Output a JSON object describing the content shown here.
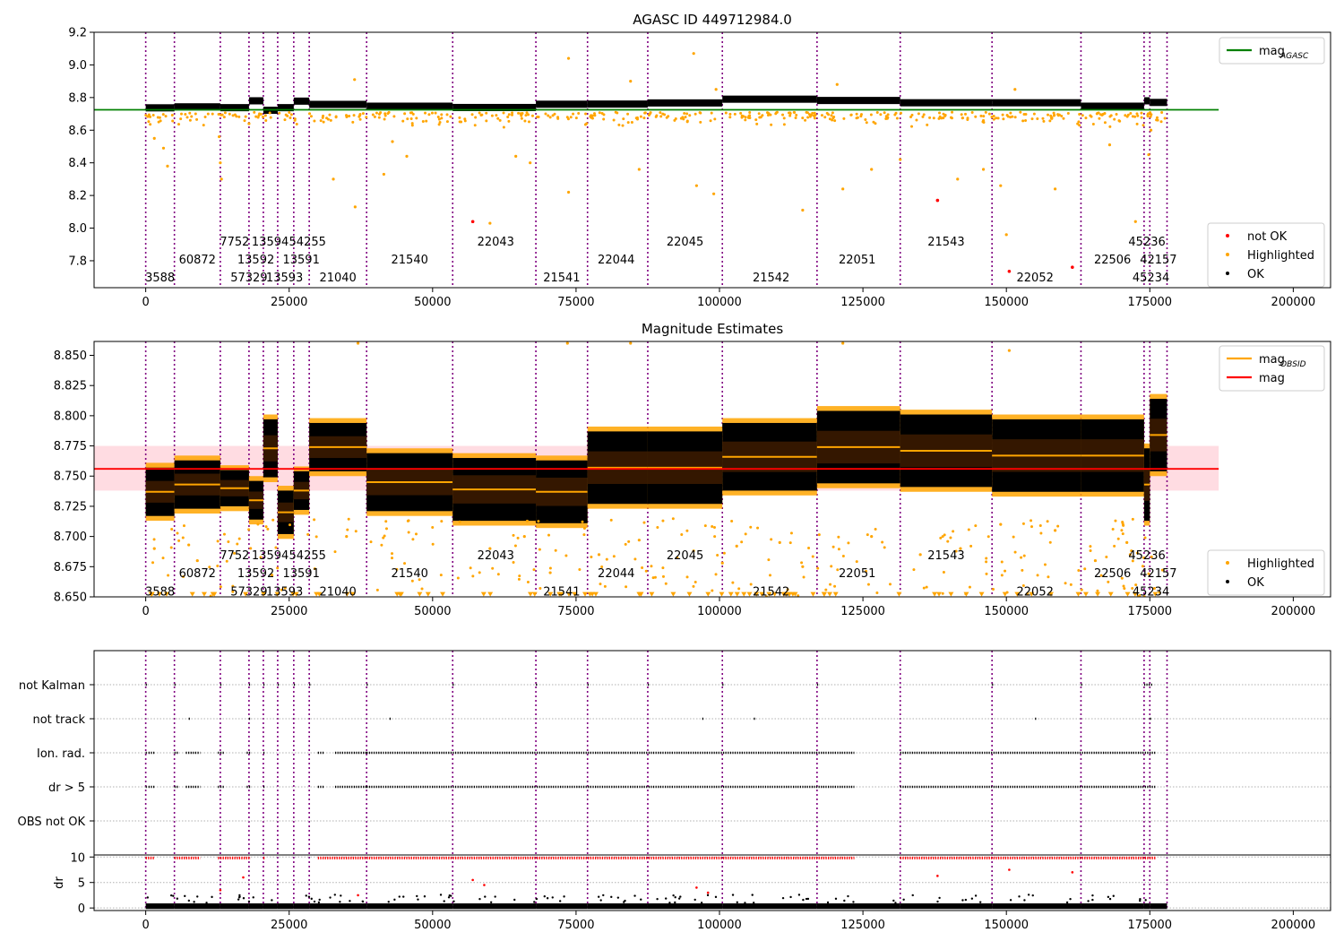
{
  "colors": {
    "ok": "#000000",
    "highlighted": "#ffa500",
    "not_ok": "#ff0000",
    "mag_agasc": "#008000",
    "mag_obsid": "#ffa500",
    "mag": "#ff0000",
    "mag_band": "#ffc0cb",
    "obsid_line": "#800080",
    "grid": "#b0b0b0"
  },
  "obsid_boundaries": [
    0,
    5000,
    13000,
    18000,
    20500,
    23000,
    25800,
    28500,
    38500,
    53500,
    68000,
    77000,
    87500,
    100500,
    117000,
    131500,
    147500,
    163000,
    174000,
    175000,
    178000
  ],
  "obsid_labels": [
    {
      "text": "3588",
      "x": 2500,
      "row": 0
    },
    {
      "text": "60872",
      "x": 9000,
      "row": 1
    },
    {
      "text": "7752",
      "x": 15500,
      "row": 2
    },
    {
      "text": "57329",
      "x": 18000,
      "row": 0
    },
    {
      "text": "13592",
      "x": 19200,
      "row": 1
    },
    {
      "text": "13594",
      "x": 21700,
      "row": 2
    },
    {
      "text": "13593",
      "x": 24200,
      "row": 0
    },
    {
      "text": "13591",
      "x": 27100,
      "row": 1
    },
    {
      "text": "54255",
      "x": 28200,
      "row": 2
    },
    {
      "text": "21040",
      "x": 33500,
      "row": 0
    },
    {
      "text": "21540",
      "x": 46000,
      "row": 1
    },
    {
      "text": "22043",
      "x": 61000,
      "row": 2
    },
    {
      "text": "21541",
      "x": 72500,
      "row": 0
    },
    {
      "text": "22044",
      "x": 82000,
      "row": 1
    },
    {
      "text": "22045",
      "x": 94000,
      "row": 2
    },
    {
      "text": "21542",
      "x": 109000,
      "row": 0
    },
    {
      "text": "22051",
      "x": 124000,
      "row": 1
    },
    {
      "text": "21543",
      "x": 139500,
      "row": 2
    },
    {
      "text": "22052",
      "x": 155000,
      "row": 0
    },
    {
      "text": "22506",
      "x": 168500,
      "row": 1
    },
    {
      "text": "45236",
      "x": 174500,
      "row": 2
    },
    {
      "text": "42157",
      "x": 176500,
      "row": 1
    },
    {
      "text": "45234",
      "x": 175200,
      "row": 0
    }
  ],
  "chart_data": [
    {
      "type": "scatter",
      "title": "AGASC ID 449712984.0",
      "xlim": [
        -9000,
        206500
      ],
      "ylim": [
        7.635,
        9.2
      ],
      "xticks": [
        0,
        25000,
        50000,
        75000,
        100000,
        125000,
        150000,
        175000,
        200000
      ],
      "yticks": [
        7.8,
        8.0,
        8.2,
        8.4,
        8.6,
        8.8,
        9.0,
        9.2
      ],
      "ytick_labels": [
        "7.8",
        "8.0",
        "8.2",
        "8.4",
        "8.6",
        "8.8",
        "9.0",
        "9.2"
      ],
      "mag_agasc": 8.725,
      "mag_agasc_xrange": [
        -9000,
        187000
      ],
      "obsid_mags": [
        8.737,
        8.743,
        8.738,
        8.78,
        8.722,
        8.738,
        8.778,
        8.758,
        8.747,
        8.739,
        8.759,
        8.76,
        8.767,
        8.79,
        8.782,
        8.768,
        8.768,
        8.747,
        8.78,
        8.77
      ],
      "not_ok_points": [
        {
          "x": 57000,
          "y": 8.04
        },
        {
          "x": 138000,
          "y": 8.17
        },
        {
          "x": 150500,
          "y": 7.735
        },
        {
          "x": 161500,
          "y": 7.76
        }
      ],
      "highlighted_sample": [
        {
          "x": 1500,
          "y": 8.55
        },
        {
          "x": 3100,
          "y": 8.49
        },
        {
          "x": 3800,
          "y": 8.38
        },
        {
          "x": 13000,
          "y": 8.4
        },
        {
          "x": 13200,
          "y": 8.3
        },
        {
          "x": 12800,
          "y": 8.56
        },
        {
          "x": 18000,
          "y": 8.64
        },
        {
          "x": 36400,
          "y": 8.91
        },
        {
          "x": 32700,
          "y": 8.3
        },
        {
          "x": 36500,
          "y": 8.13
        },
        {
          "x": 43000,
          "y": 8.53
        },
        {
          "x": 41500,
          "y": 8.33
        },
        {
          "x": 45500,
          "y": 8.44
        },
        {
          "x": 60000,
          "y": 8.03
        },
        {
          "x": 64500,
          "y": 8.44
        },
        {
          "x": 67000,
          "y": 8.4
        },
        {
          "x": 73700,
          "y": 9.04
        },
        {
          "x": 73700,
          "y": 8.22
        },
        {
          "x": 84500,
          "y": 8.9
        },
        {
          "x": 86000,
          "y": 8.36
        },
        {
          "x": 95500,
          "y": 9.07
        },
        {
          "x": 96000,
          "y": 8.26
        },
        {
          "x": 99000,
          "y": 8.21
        },
        {
          "x": 99400,
          "y": 8.85
        },
        {
          "x": 114500,
          "y": 8.11
        },
        {
          "x": 120500,
          "y": 8.88
        },
        {
          "x": 121500,
          "y": 8.24
        },
        {
          "x": 126500,
          "y": 8.36
        },
        {
          "x": 131500,
          "y": 8.42
        },
        {
          "x": 141500,
          "y": 8.3
        },
        {
          "x": 146000,
          "y": 8.36
        },
        {
          "x": 149000,
          "y": 8.26
        },
        {
          "x": 150000,
          "y": 7.96
        },
        {
          "x": 158500,
          "y": 8.24
        },
        {
          "x": 151500,
          "y": 8.85
        },
        {
          "x": 168000,
          "y": 8.51
        },
        {
          "x": 172500,
          "y": 8.04
        },
        {
          "x": 174800,
          "y": 8.45
        },
        {
          "x": 175200,
          "y": 8.6
        }
      ],
      "legend_top": [
        {
          "label": "mag",
          "sub": "AGASC",
          "marker": "line",
          "color_key": "mag_agasc"
        }
      ],
      "legend_bottom": [
        {
          "label": "not OK",
          "marker": "dot",
          "color_key": "not_ok"
        },
        {
          "label": "Highlighted",
          "marker": "dot",
          "color_key": "highlighted"
        },
        {
          "label": "OK",
          "marker": "dot",
          "color_key": "ok"
        }
      ]
    },
    {
      "type": "scatter",
      "title": "Magnitude Estimates",
      "xlim": [
        -9000,
        206500
      ],
      "ylim": [
        8.65,
        8.8615
      ],
      "xticks": [
        0,
        25000,
        50000,
        75000,
        100000,
        125000,
        150000,
        175000,
        200000
      ],
      "yticks": [
        8.65,
        8.675,
        8.7,
        8.725,
        8.75,
        8.775,
        8.8,
        8.825,
        8.85
      ],
      "ytick_labels": [
        "8.650",
        "8.675",
        "8.700",
        "8.725",
        "8.750",
        "8.775",
        "8.800",
        "8.825",
        "8.850"
      ],
      "mag": 8.756,
      "mag_band": [
        8.738,
        8.775
      ],
      "mag_xrange": [
        -9000,
        187000
      ],
      "obsid_mags": [
        8.737,
        8.743,
        8.74,
        8.73,
        8.773,
        8.72,
        8.738,
        8.774,
        8.745,
        8.739,
        8.737,
        8.757,
        8.757,
        8.766,
        8.774,
        8.771,
        8.767,
        8.767,
        8.743,
        8.784,
        8.781
      ],
      "obsid_spread": [
        0.02,
        0.02,
        0.015,
        0.016,
        0.024,
        0.018,
        0.016,
        0.02,
        0.024,
        0.026,
        0.026,
        0.03,
        0.03,
        0.028,
        0.03,
        0.03,
        0.03,
        0.03,
        0.03,
        0.03,
        0.03
      ],
      "highlighted_sample": [
        {
          "x": 37000,
          "y": 8.86
        },
        {
          "x": 73500,
          "y": 8.86
        },
        {
          "x": 84500,
          "y": 8.86
        },
        {
          "x": 121500,
          "y": 8.86
        },
        {
          "x": 150500,
          "y": 8.854
        },
        {
          "x": 1500,
          "y": 8.69
        },
        {
          "x": 7500,
          "y": 8.693
        },
        {
          "x": 9000,
          "y": 8.68
        },
        {
          "x": 22000,
          "y": 8.668
        },
        {
          "x": 35000,
          "y": 8.7
        },
        {
          "x": 60000,
          "y": 8.69
        },
        {
          "x": 66000,
          "y": 8.7
        },
        {
          "x": 70500,
          "y": 8.67
        },
        {
          "x": 79000,
          "y": 8.685
        },
        {
          "x": 86000,
          "y": 8.697
        },
        {
          "x": 100500,
          "y": 8.678
        },
        {
          "x": 103000,
          "y": 8.692
        },
        {
          "x": 110500,
          "y": 8.695
        },
        {
          "x": 114500,
          "y": 8.675
        },
        {
          "x": 126500,
          "y": 8.7
        },
        {
          "x": 135000,
          "y": 8.685
        },
        {
          "x": 142000,
          "y": 8.69
        },
        {
          "x": 149000,
          "y": 8.71
        },
        {
          "x": 158500,
          "y": 8.705
        },
        {
          "x": 165500,
          "y": 8.68
        },
        {
          "x": 171000,
          "y": 8.695
        }
      ],
      "legend_top": [
        {
          "label": "mag",
          "sub": "OBSID",
          "marker": "line",
          "color_key": "mag_obsid"
        },
        {
          "label": "mag",
          "marker": "line",
          "color_key": "mag"
        }
      ],
      "legend_bottom": [
        {
          "label": "Highlighted",
          "marker": "dot",
          "color_key": "highlighted"
        },
        {
          "label": "OK",
          "marker": "dot",
          "color_key": "ok"
        }
      ]
    },
    {
      "type": "scatter",
      "title": "",
      "xlim": [
        -9000,
        206500
      ],
      "xticks": [
        0,
        25000,
        50000,
        75000,
        100000,
        125000,
        150000,
        175000,
        200000
      ],
      "categories": [
        "not Kalman",
        "not track",
        "Ion. rad.",
        "dr > 5",
        "OBS not OK"
      ],
      "flag_segments": {
        "not Kalman": [
          [
            0,
            200
          ],
          [
            5000,
            5200
          ],
          [
            13000,
            13200
          ],
          [
            18000,
            18300
          ],
          [
            20500,
            20700
          ],
          [
            23000,
            23200
          ],
          [
            25800,
            26000
          ],
          [
            28500,
            28800
          ],
          [
            38500,
            38700
          ],
          [
            53500,
            53700
          ],
          [
            68000,
            68200
          ],
          [
            77000,
            77200
          ],
          [
            87500,
            87700
          ],
          [
            100500,
            100700
          ],
          [
            117000,
            117200
          ],
          [
            147500,
            147700
          ],
          [
            163000,
            163200
          ],
          [
            174000,
            175500
          ]
        ],
        "not track": [
          [
            7500,
            7700
          ],
          [
            18000,
            18200
          ],
          [
            42500,
            42700
          ],
          [
            97000,
            97200
          ],
          [
            106000,
            106200
          ],
          [
            155000,
            155200
          ],
          [
            175000,
            175200
          ]
        ],
        "Ion. rad.": [
          [
            0,
            200
          ],
          [
            500,
            1500
          ],
          [
            5000,
            5600
          ],
          [
            7000,
            9500
          ],
          [
            12600,
            13600
          ],
          [
            17600,
            18300
          ],
          [
            20500,
            20800
          ],
          [
            30000,
            31000
          ],
          [
            33000,
            38500
          ],
          [
            38500,
            123500
          ],
          [
            131500,
            176000
          ]
        ],
        "dr > 5": [
          [
            0,
            200
          ],
          [
            500,
            1500
          ],
          [
            5000,
            5600
          ],
          [
            7000,
            9500
          ],
          [
            12600,
            13600
          ],
          [
            17600,
            18300
          ],
          [
            20500,
            20800
          ],
          [
            30000,
            31000
          ],
          [
            33000,
            38500
          ],
          [
            38500,
            123500
          ],
          [
            131500,
            176000
          ]
        ],
        "OBS not OK": []
      },
      "dr_ylim": [
        -0.5,
        10.4
      ],
      "dr_yticks": [
        0,
        5,
        10
      ],
      "dr_ylabel": "dr",
      "dr_red_level": 9.8,
      "dr_red_segments": [
        [
          0,
          1500
        ],
        [
          5000,
          9500
        ],
        [
          12600,
          18300
        ],
        [
          20500,
          20800
        ],
        [
          30000,
          38500
        ],
        [
          38500,
          123500
        ],
        [
          131500,
          176000
        ]
      ],
      "dr_red_outliers": [
        {
          "x": 13000,
          "y": 3.5
        },
        {
          "x": 37000,
          "y": 2.5
        },
        {
          "x": 57000,
          "y": 5.5
        },
        {
          "x": 59000,
          "y": 4.5
        },
        {
          "x": 96000,
          "y": 4.0
        },
        {
          "x": 98000,
          "y": 3.0
        },
        {
          "x": 138000,
          "y": 6.3
        },
        {
          "x": 150500,
          "y": 7.5
        },
        {
          "x": 161500,
          "y": 7.0
        },
        {
          "x": 17000,
          "y": 6.0
        }
      ]
    }
  ]
}
